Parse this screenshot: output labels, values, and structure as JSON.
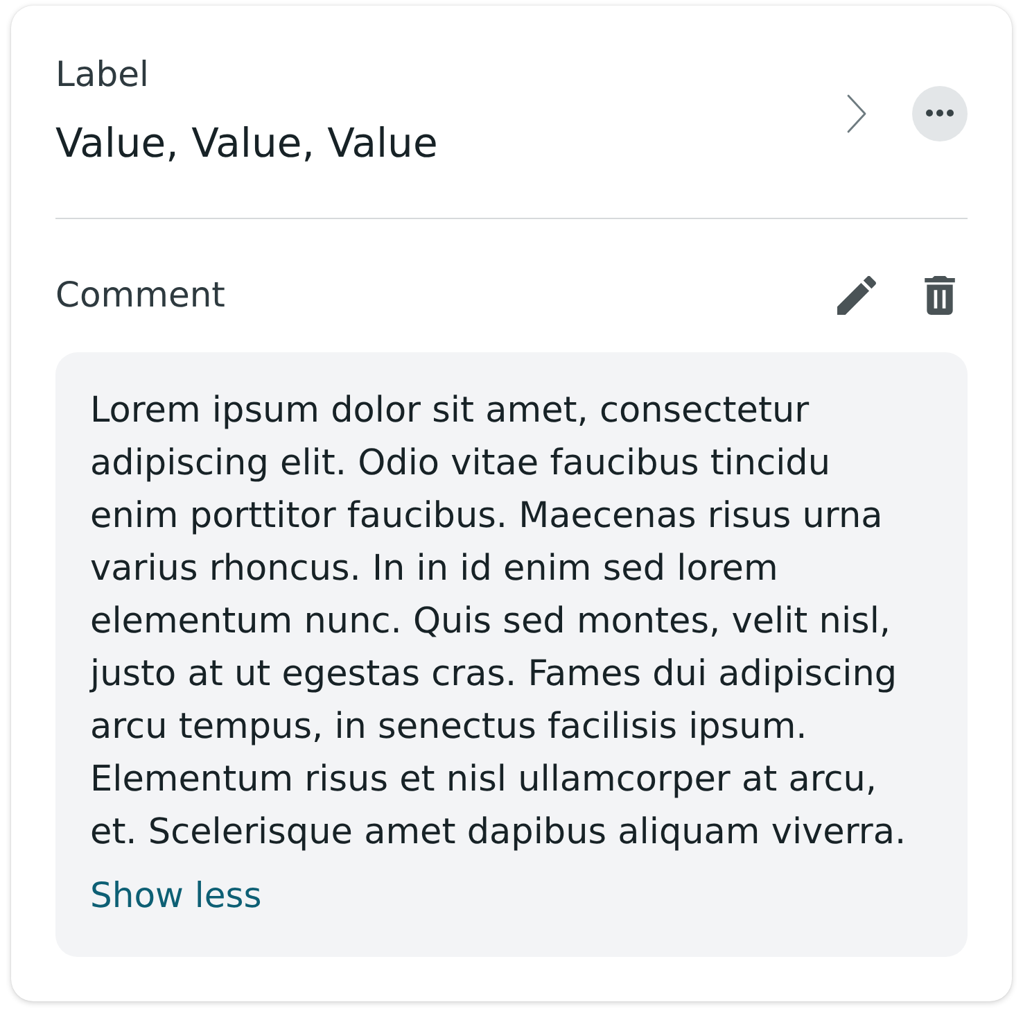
{
  "field": {
    "label": "Label",
    "value": "Value, Value, Value"
  },
  "comment": {
    "label": "Comment",
    "text": "Lorem ipsum dolor sit amet, consectetur adipiscing elit. Odio vitae faucibus tincidu enim porttitor faucibus. Maecenas risus urna varius rhoncus. In in id enim sed lorem elementum nunc. Quis sed montes, velit nisl, justo at ut egestas cras. Fames dui adipiscing arcu tempus, in senectus facilisis ipsum. Elementum risus et nisl ullamcorper at arcu, et. Scelerisque amet dapibus aliquam viverra.",
    "toggle": "Show less"
  }
}
